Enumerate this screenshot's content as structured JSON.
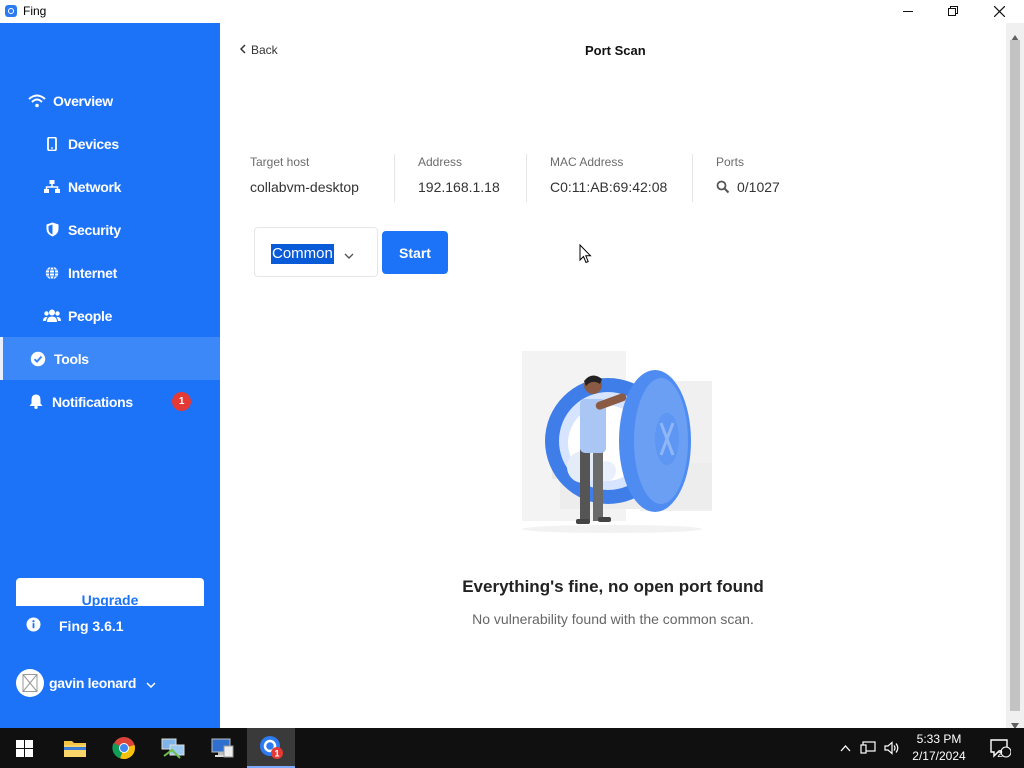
{
  "window": {
    "title": "Fing"
  },
  "sidebar": {
    "items": [
      {
        "label": "Overview",
        "icon": "wifi-icon"
      },
      {
        "label": "Devices",
        "icon": "phone-icon"
      },
      {
        "label": "Network",
        "icon": "network-icon"
      },
      {
        "label": "Security",
        "icon": "shield-icon"
      },
      {
        "label": "Internet",
        "icon": "globe-icon"
      },
      {
        "label": "People",
        "icon": "people-icon"
      },
      {
        "label": "Tools",
        "icon": "check-circle-icon",
        "active": true
      },
      {
        "label": "Notifications",
        "icon": "bell-icon",
        "badge": "1"
      }
    ],
    "upgrade_label": "Upgrade",
    "version": "Fing 3.6.1",
    "user_name": "gavin leonard"
  },
  "header": {
    "back_label": "Back",
    "title": "Port Scan"
  },
  "scan_info": {
    "target_host_label": "Target host",
    "target_host": "collabvm-desktop",
    "address_label": "Address",
    "address": "192.168.1.18",
    "mac_label": "MAC Address",
    "mac": "C0:11:AB:69:42:08",
    "ports_label": "Ports",
    "ports": "0/1027"
  },
  "controls": {
    "scan_type": "Common",
    "start_label": "Start"
  },
  "empty_state": {
    "title": "Everything's fine, no open port found",
    "subtitle": "No vulnerability found with the common scan."
  },
  "taskbar": {
    "time": "5:33 PM",
    "date": "2/17/2024",
    "notification_count": "2",
    "fing_badge": "1"
  },
  "colors": {
    "brand_blue": "#1c73f7",
    "badge_red": "#e53935"
  }
}
